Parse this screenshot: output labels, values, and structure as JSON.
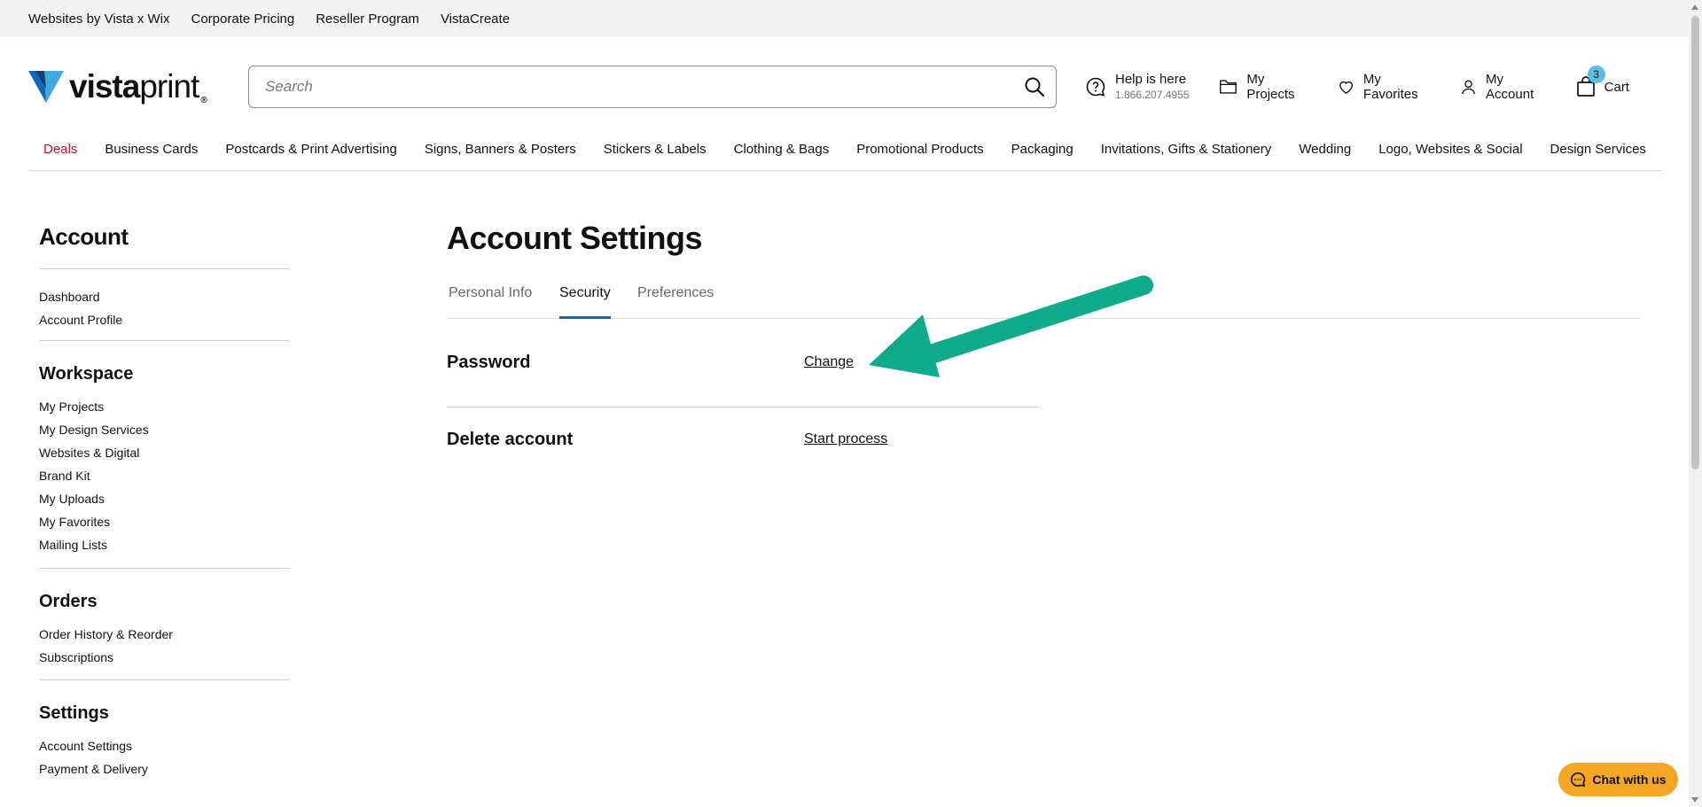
{
  "utility_bar": {
    "links": [
      "Websites by Vista x Wix",
      "Corporate Pricing",
      "Reseller Program",
      "VistaCreate"
    ]
  },
  "header": {
    "logo_bold": "vista",
    "logo_light": "print",
    "logo_reg": "®",
    "search_placeholder": "Search",
    "help_label": "Help is here",
    "help_phone": "1.866.207.4955",
    "my_projects": "My Projects",
    "my_favorites": "My Favorites",
    "my_account": "My Account",
    "cart_label": "Cart",
    "cart_count": "3"
  },
  "main_nav": [
    "Deals",
    "Business Cards",
    "Postcards & Print Advertising",
    "Signs, Banners & Posters",
    "Stickers & Labels",
    "Clothing & Bags",
    "Promotional Products",
    "Packaging",
    "Invitations, Gifts & Stationery",
    "Wedding",
    "Logo, Websites & Social",
    "Design Services"
  ],
  "sidebar": {
    "title": "Account",
    "account_links": [
      "Dashboard",
      "Account Profile"
    ],
    "workspace_title": "Workspace",
    "workspace_links": [
      "My Projects",
      "My Design Services",
      "Websites & Digital",
      "Brand Kit",
      "My Uploads",
      "My Favorites",
      "Mailing Lists"
    ],
    "orders_title": "Orders",
    "orders_links": [
      "Order History & Reorder",
      "Subscriptions"
    ],
    "settings_title": "Settings",
    "settings_links": [
      "Account Settings",
      "Payment & Delivery"
    ]
  },
  "content": {
    "title": "Account Settings",
    "tabs": [
      "Personal Info",
      "Security",
      "Preferences"
    ],
    "active_tab": "Security",
    "rows": [
      {
        "label": "Password",
        "link": "Change"
      },
      {
        "label": "Delete account",
        "link": "Start process"
      }
    ]
  },
  "chat": {
    "label": "Chat with us"
  },
  "colors": {
    "accent_blue": "#0a6ab9",
    "deals_red": "#c8102e",
    "chat_orange": "#f5a623",
    "arrow_green": "#0fac8b",
    "badge_blue": "#5bc0e8"
  }
}
